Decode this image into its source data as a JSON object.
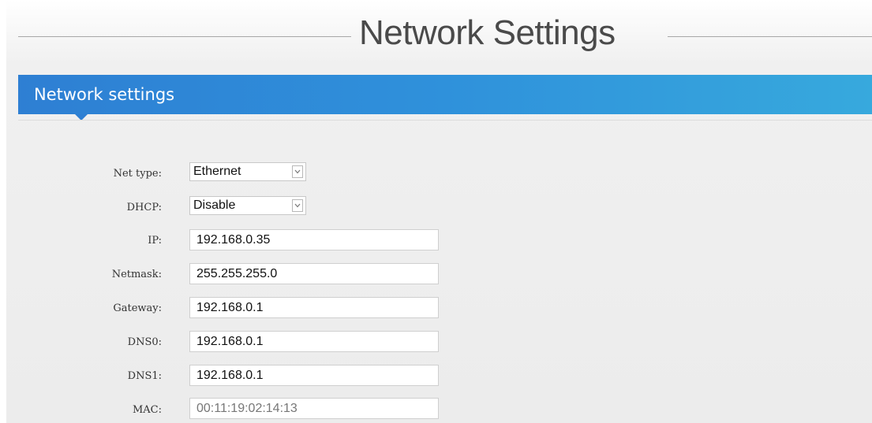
{
  "page": {
    "title": "Network Settings"
  },
  "section": {
    "title": "Network settings"
  },
  "form": {
    "net_type": {
      "label": "Net type:",
      "value": "Ethernet"
    },
    "dhcp": {
      "label": "DHCP:",
      "value": "Disable"
    },
    "ip": {
      "label": "IP:",
      "value": "192.168.0.35"
    },
    "netmask": {
      "label": "Netmask:",
      "value": "255.255.255.0"
    },
    "gateway": {
      "label": "Gateway:",
      "value": "192.168.0.1"
    },
    "dns0": {
      "label": "DNS0:",
      "value": "192.168.0.1"
    },
    "dns1": {
      "label": "DNS1:",
      "value": "192.168.0.1"
    },
    "mac": {
      "label": "MAC:",
      "value": "00:11:19:02:14:13"
    }
  },
  "icons": {
    "dropdown": "chevron-down-icon"
  },
  "colors": {
    "header_gradient_start": "#2e7fd3",
    "header_gradient_end": "#37a9dd",
    "header_text": "#ffffff",
    "page_title_text": "#4a4a4a"
  }
}
